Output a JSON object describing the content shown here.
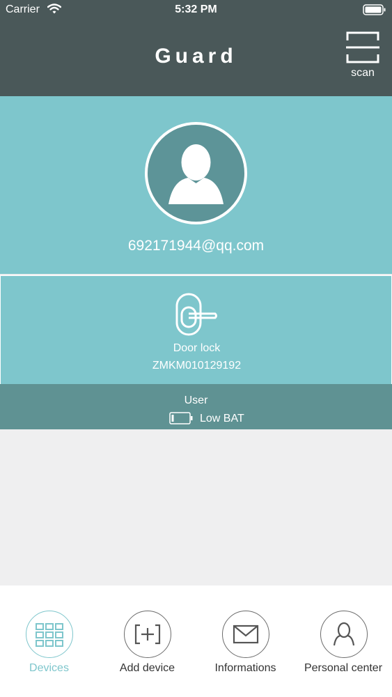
{
  "status_bar": {
    "carrier": "Carrier",
    "time": "5:32 PM"
  },
  "header": {
    "title": "Guard",
    "scan_label": "scan"
  },
  "profile": {
    "email": "692171944@qq.com"
  },
  "device": {
    "name": "Door lock",
    "id": "ZMKM010129192",
    "role": "User",
    "battery_status": "Low BAT"
  },
  "tabs": [
    {
      "label": "Devices",
      "icon": "grid-icon",
      "active": true
    },
    {
      "label": "Add device",
      "icon": "add-box-icon",
      "active": false
    },
    {
      "label": "Informations",
      "icon": "envelope-icon",
      "active": false
    },
    {
      "label": "Personal center",
      "icon": "person-icon",
      "active": false
    }
  ],
  "colors": {
    "header_bg": "#4a5859",
    "accent": "#7ec6cc",
    "status_strip": "#5f9293",
    "avatar_bg": "#5d9498"
  }
}
